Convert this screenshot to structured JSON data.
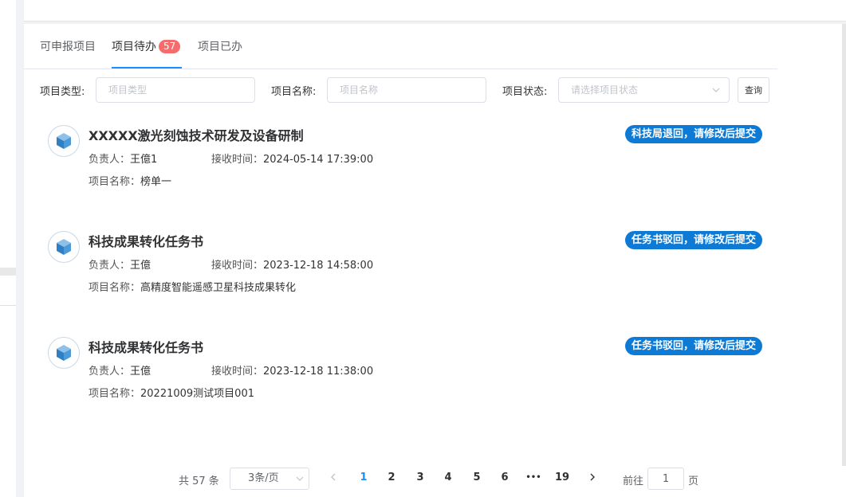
{
  "tabs": [
    {
      "label": "可申报项目"
    },
    {
      "label": "项目待办",
      "badge": "57"
    },
    {
      "label": "项目已办"
    }
  ],
  "filters": {
    "type_label": "项目类型:",
    "type_placeholder": "项目类型",
    "name_label": "项目名称:",
    "name_placeholder": "项目名称",
    "status_label": "项目状态:",
    "status_placeholder": "请选择项目状态",
    "query_label": "查询"
  },
  "items": [
    {
      "title": "XXXXX激光刻蚀技术研发及设备研制",
      "status": "科技局退回，请修改后提交",
      "owner_label": "负责人：",
      "owner": "王億1",
      "time_label": "接收时间：",
      "time": "2024-05-14 17:39:00",
      "proj_label": "项目名称：",
      "proj_name": "榜单一"
    },
    {
      "title": "科技成果转化任务书",
      "status": "任务书驳回，请修改后提交",
      "owner_label": "负责人：",
      "owner": "王億",
      "time_label": "接收时间：",
      "time": "2023-12-18 14:58:00",
      "proj_label": "项目名称：",
      "proj_name": "高精度智能遥感卫星科技成果转化"
    },
    {
      "title": "科技成果转化任务书",
      "status": "任务书驳回，请修改后提交",
      "owner_label": "负责人：",
      "owner": "王億",
      "time_label": "接收时间：",
      "time": "2023-12-18 11:38:00",
      "proj_label": "项目名称：",
      "proj_name": "20221009测试项目001"
    }
  ],
  "pagination": {
    "total": "共 57 条",
    "page_size": "3条/页",
    "pages": [
      "1",
      "2",
      "3",
      "4",
      "5",
      "6",
      "•••",
      "19"
    ],
    "current": "1",
    "goto_label": "前往",
    "goto_value": "1",
    "page_suffix": "页"
  },
  "colors": {
    "accent": "#1890ff",
    "badge": "#f56c6c",
    "status_tag": "#0d7ad6"
  }
}
